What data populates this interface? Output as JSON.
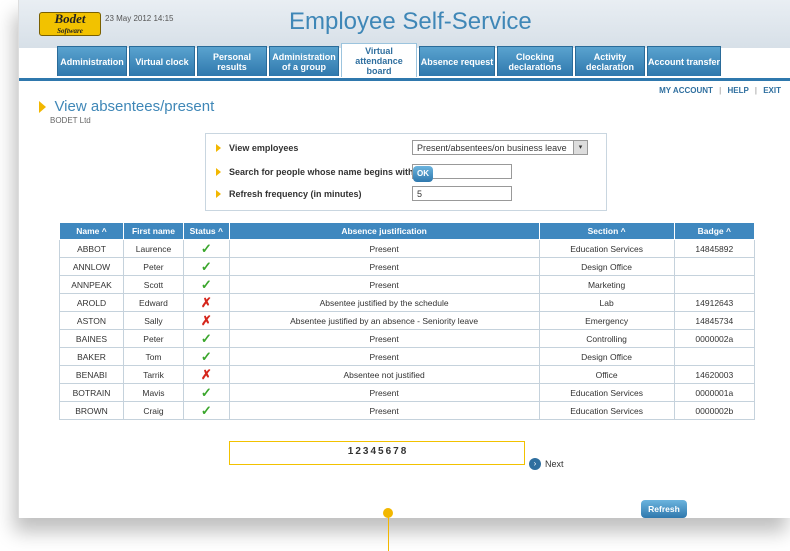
{
  "header": {
    "logo_text": "Bodet",
    "logo_sub": "Software",
    "datetime": "23 May 2012 14:15",
    "app_title": "Employee Self-Service"
  },
  "tabs": [
    {
      "label": "Administration",
      "active": false
    },
    {
      "label": "Virtual clock",
      "active": false
    },
    {
      "label": "Personal results",
      "active": false
    },
    {
      "label": "Administration of a group",
      "active": false
    },
    {
      "label": "Virtual attendance board",
      "active": true
    },
    {
      "label": "Absence request",
      "active": false
    },
    {
      "label": "Clocking declarations",
      "active": false
    },
    {
      "label": "Activity declaration",
      "active": false
    },
    {
      "label": "Account transfer",
      "active": false
    }
  ],
  "toplinks": {
    "my_account": "MY ACCOUNT",
    "help": "HELP",
    "exit": "EXIT",
    "sep": "|"
  },
  "page": {
    "title": "View absentees/present",
    "company": "BODET Ltd"
  },
  "filters": {
    "view_label": "View employees",
    "view_value": "Present/absentees/on business leave",
    "search_label": "Search for people whose name begins with",
    "search_value": "",
    "refresh_label": "Refresh frequency (in minutes)",
    "refresh_value": "5",
    "ok_label": "OK",
    "arrow": "▾"
  },
  "table": {
    "headers": {
      "name": "Name ^",
      "first_name": "First name",
      "status": "Status ^",
      "justification": "Absence justification",
      "section": "Section ^",
      "badge": "Badge ^"
    },
    "rows": [
      {
        "name": "ABBOT",
        "first": "Laurence",
        "status": "present",
        "status_glyph": "✓",
        "just": "Present",
        "section": "Education Services",
        "badge": "14845892"
      },
      {
        "name": "ANNLOW",
        "first": "Peter",
        "status": "present",
        "status_glyph": "✓",
        "just": "Present",
        "section": "Design Office",
        "badge": ""
      },
      {
        "name": "ANNPEAK",
        "first": "Scott",
        "status": "present",
        "status_glyph": "✓",
        "just": "Present",
        "section": "Marketing",
        "badge": ""
      },
      {
        "name": "AROLD",
        "first": "Edward",
        "status": "absent",
        "status_glyph": "✗",
        "just": "Absentee justified by the schedule",
        "section": "Lab",
        "badge": "14912643"
      },
      {
        "name": "ASTON",
        "first": "Sally",
        "status": "absent",
        "status_glyph": "✗",
        "just": "Absentee justified by an absence - Seniority leave",
        "section": "Emergency",
        "badge": "14845734"
      },
      {
        "name": "BAINES",
        "first": "Peter",
        "status": "present",
        "status_glyph": "✓",
        "just": "Present",
        "section": "Controlling",
        "badge": "0000002a"
      },
      {
        "name": "BAKER",
        "first": "Tom",
        "status": "present",
        "status_glyph": "✓",
        "just": "Present",
        "section": "Design Office",
        "badge": ""
      },
      {
        "name": "BENABI",
        "first": "Tarrik",
        "status": "absent",
        "status_glyph": "✗",
        "just": "Absentee not justified",
        "section": "Office",
        "badge": "14620003"
      },
      {
        "name": "BOTRAIN",
        "first": "Mavis",
        "status": "present",
        "status_glyph": "✓",
        "just": "Present",
        "section": "Education Services",
        "badge": "0000001a"
      },
      {
        "name": "BROWN",
        "first": "Craig",
        "status": "present",
        "status_glyph": "✓",
        "just": "Present",
        "section": "Education Services",
        "badge": "0000002b"
      }
    ]
  },
  "pager": {
    "pages": [
      "1",
      "2",
      "3",
      "4",
      "5",
      "6",
      "7",
      "8"
    ],
    "next_label": "Next",
    "next_glyph": "›"
  },
  "refresh_button": "Refresh",
  "colors": {
    "accent": "#3f87b7",
    "brand_yellow": "#f2c200",
    "present": "#3aa62c",
    "absent": "#d5261c"
  }
}
